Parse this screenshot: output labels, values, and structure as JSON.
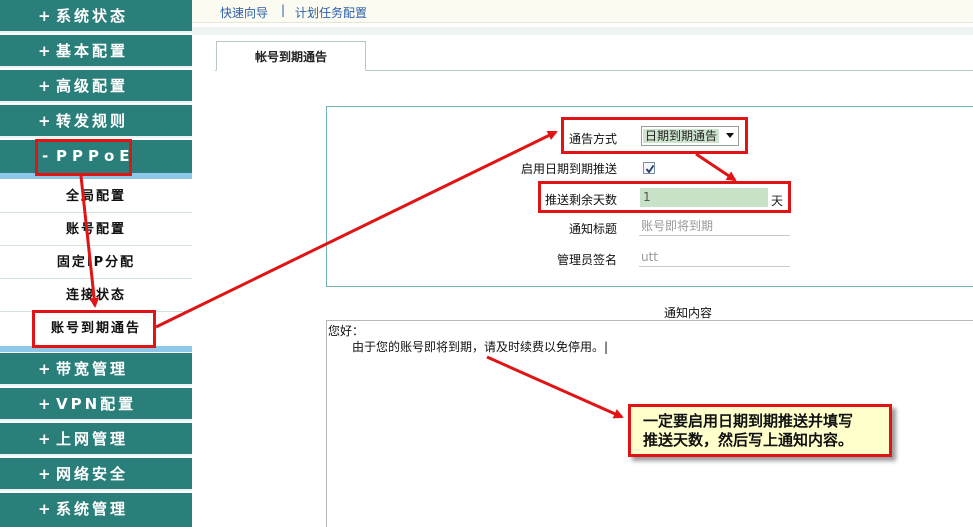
{
  "sidebar": {
    "groups_top": [
      {
        "sign": "+",
        "label": "系统状态"
      },
      {
        "sign": "+",
        "label": "基本配置"
      },
      {
        "sign": "+",
        "label": "高级配置"
      },
      {
        "sign": "+",
        "label": "转发规则"
      }
    ],
    "pppoe": {
      "sign": "-",
      "label": "PPPoE"
    },
    "submenu": [
      "全局配置",
      "账号配置",
      "固定IP分配",
      "连接状态",
      "账号到期通告"
    ],
    "groups_bottom": [
      {
        "sign": "+",
        "label": "带宽管理"
      },
      {
        "sign": "+",
        "label": "VPN配置"
      },
      {
        "sign": "+",
        "label": "上网管理"
      },
      {
        "sign": "+",
        "label": "网络安全"
      },
      {
        "sign": "+",
        "label": "系统管理"
      }
    ]
  },
  "topbar": {
    "link1": "快速向导",
    "separator": "|",
    "link2": "计划任务配置"
  },
  "tab": {
    "label": "帐号到期通告"
  },
  "form": {
    "notify_method_label": "通告方式",
    "notify_method_value": "日期到期通告",
    "enable_label": "启用日期到期推送",
    "enable_checked": true,
    "days_label": "推送剩余天数",
    "days_value": "1",
    "days_unit": "天",
    "title_label": "通知标题",
    "title_placeholder": "账号即将到期",
    "admin_label": "管理员签名",
    "admin_placeholder": "utt"
  },
  "content": {
    "title": "通知内容",
    "greeting": "您好：",
    "body": "由于您的账号即将到期，请及时续费以免停用。|"
  },
  "note": {
    "line1": "一定要启用日期到期推送并填写",
    "line2": "推送天数，然后写上通知内容。"
  },
  "colors": {
    "sidebar_bg": "#2a7f7b",
    "annotation_red": "#e01414",
    "note_bg": "#ffffcc",
    "link": "#2b5fa8"
  }
}
